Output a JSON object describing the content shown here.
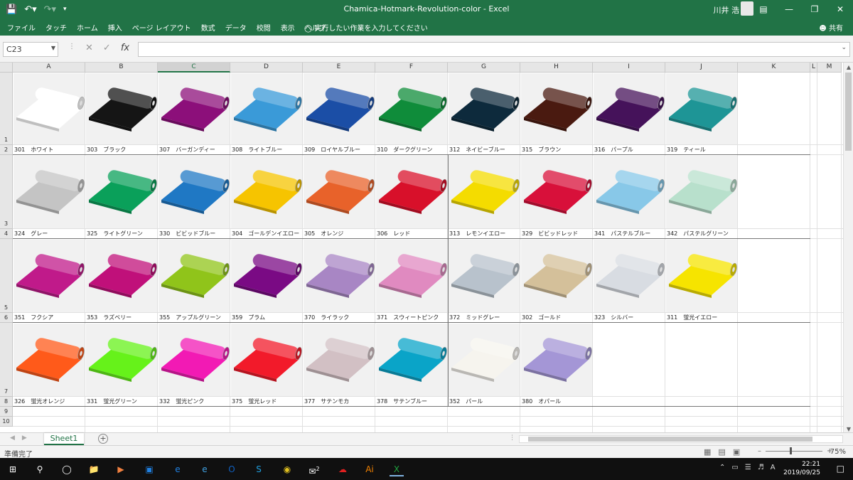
{
  "app": {
    "title": "Chamica-Hotmark-Revolution-color  -  Excel",
    "user": "川井 浩",
    "qat_icons": [
      "save-icon",
      "undo-icon",
      "redo-icon",
      "customize-qat-icon"
    ],
    "window_controls": [
      "ribbon-display-icon",
      "minimize-icon",
      "restore-icon",
      "close-icon"
    ]
  },
  "menu": {
    "items": [
      "ファイル",
      "タッチ",
      "ホーム",
      "挿入",
      "ページ レイアウト",
      "数式",
      "データ",
      "校閲",
      "表示",
      "ヘルプ"
    ],
    "tell_me": "実行したい作業を入力してください",
    "share": "共有"
  },
  "formula": {
    "name_box": "C23",
    "fx": "fx",
    "value": ""
  },
  "columns": [
    "A",
    "B",
    "C",
    "D",
    "E",
    "F",
    "G",
    "H",
    "I",
    "J",
    "K",
    "L",
    "M"
  ],
  "selected_column": "C",
  "rows": [
    "1",
    "2",
    "3",
    "4",
    "5",
    "6",
    "7",
    "8",
    "9",
    "10"
  ],
  "swatches": [
    [
      {
        "label": "301　ホワイト",
        "color": "#ffffff"
      },
      {
        "label": "303　ブラック",
        "color": "#151515"
      },
      {
        "label": "307　バーガンディー",
        "color": "#8c0f7a"
      },
      {
        "label": "308　ライトブルー",
        "color": "#3a9ad8"
      },
      {
        "label": "309　ロイヤルブルー",
        "color": "#1b4ea6"
      },
      {
        "label": "310　ダークグリーン",
        "color": "#0f8c3a"
      },
      {
        "label": "312　ネイビーブルー",
        "color": "#0d2a3c"
      },
      {
        "label": "315　ブラウン",
        "color": "#4a1a10"
      },
      {
        "label": "316　パープル",
        "color": "#45125a"
      },
      {
        "label": "319　ティール",
        "color": "#1e9596"
      }
    ],
    [
      {
        "label": "324　グレー",
        "color": "#c4c4c4"
      },
      {
        "label": "325　ライトグリーン",
        "color": "#0aa05a"
      },
      {
        "label": "330　ビビッドブルー",
        "color": "#1f78c4"
      },
      {
        "label": "304　ゴールデンイエロー",
        "color": "#f6c400"
      },
      {
        "label": "305　オレンジ",
        "color": "#e8622a"
      },
      {
        "label": "306　レッド",
        "color": "#d8102a"
      },
      {
        "label": "313　レモンイエロー",
        "color": "#f4dc00"
      },
      {
        "label": "329　ビビッドレッド",
        "color": "#d8103a"
      },
      {
        "label": "341　パステルブルー",
        "color": "#88c8e8"
      },
      {
        "label": "342　パステルグリーン",
        "color": "#b8e0cc"
      }
    ],
    [
      {
        "label": "351　フクシア",
        "color": "#c01a8a"
      },
      {
        "label": "353　ラズベリー",
        "color": "#c0107a"
      },
      {
        "label": "355　アップルグリーン",
        "color": "#90c41a"
      },
      {
        "label": "359　プラム",
        "color": "#7a0a84"
      },
      {
        "label": "370　ライラック",
        "color": "#a886c4"
      },
      {
        "label": "371　スウィートピンク",
        "color": "#e08ac0"
      },
      {
        "label": "372　ミッドグレー",
        "color": "#b8c2cc"
      },
      {
        "label": "302　ゴールド",
        "color": "#d4c09a"
      },
      {
        "label": "323　シルバー",
        "color": "#d8dce2"
      },
      {
        "label": "311　蛍光イエロー",
        "color": "#f6e400"
      }
    ],
    [
      {
        "label": "326　蛍光オレンジ",
        "color": "#ff5a1a"
      },
      {
        "label": "331　蛍光グリーン",
        "color": "#66f21a"
      },
      {
        "label": "332　蛍光ピンク",
        "color": "#f21ab4"
      },
      {
        "label": "375　蛍光レッド",
        "color": "#f21a2a"
      },
      {
        "label": "377　サテンモカ",
        "color": "#d2c0c4"
      },
      {
        "label": "378　サテンブルー",
        "color": "#0aa4c8"
      },
      {
        "label": "352　パール",
        "color": "#f6f4ee"
      },
      {
        "label": "380　オパール",
        "color": "#a496d6"
      }
    ]
  ],
  "sheet": {
    "tab": "Sheet1",
    "add": "+"
  },
  "status": {
    "ready": "準備完了",
    "zoom": "75%"
  },
  "taskbar": {
    "time": "22:21",
    "date": "2019/09/25",
    "ime": "A",
    "mail_badge": "2",
    "apps": [
      "windows-start-icon",
      "search-icon",
      "task-view-icon",
      "file-explorer-icon",
      "media-player-icon",
      "store-icon",
      "edge-icon",
      "ie-icon",
      "outlook-icon",
      "skype-icon",
      "chrome-icon",
      "mail-icon",
      "creative-cloud-icon",
      "illustrator-icon",
      "excel-icon"
    ]
  }
}
